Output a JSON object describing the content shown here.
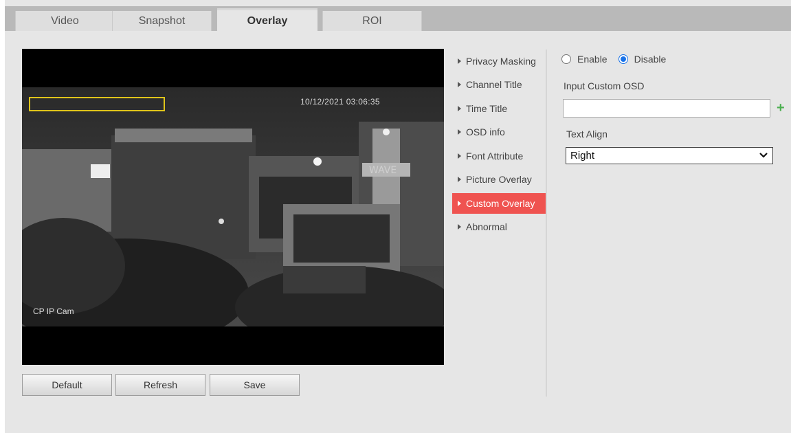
{
  "tabs": [
    {
      "label": "Video"
    },
    {
      "label": "Snapshot"
    },
    {
      "label": "Overlay"
    },
    {
      "label": "ROI"
    }
  ],
  "active_tab": "Overlay",
  "video": {
    "osd_time": "10/12/2021 03:06:35",
    "channel_name": "CP IP Cam"
  },
  "buttons": {
    "default": "Default",
    "refresh": "Refresh",
    "save": "Save"
  },
  "menu": {
    "items": [
      {
        "label": "Privacy Masking"
      },
      {
        "label": "Channel Title"
      },
      {
        "label": "Time Title"
      },
      {
        "label": "OSD info"
      },
      {
        "label": "Font Attribute"
      },
      {
        "label": "Picture Overlay"
      },
      {
        "label": "Custom Overlay"
      },
      {
        "label": "Abnormal"
      }
    ],
    "active": "Custom Overlay"
  },
  "settings": {
    "enable_label": "Enable",
    "disable_label": "Disable",
    "selected": "Disable",
    "input_label": "Input Custom OSD",
    "input_value": "",
    "text_align_label": "Text Align",
    "text_align_value": "Right"
  },
  "colors": {
    "accent_active_menu": "#ef5350",
    "radio_checked": "#1a73e8",
    "osd_box": "#e0c51a",
    "add_icon": "#4caf50"
  }
}
